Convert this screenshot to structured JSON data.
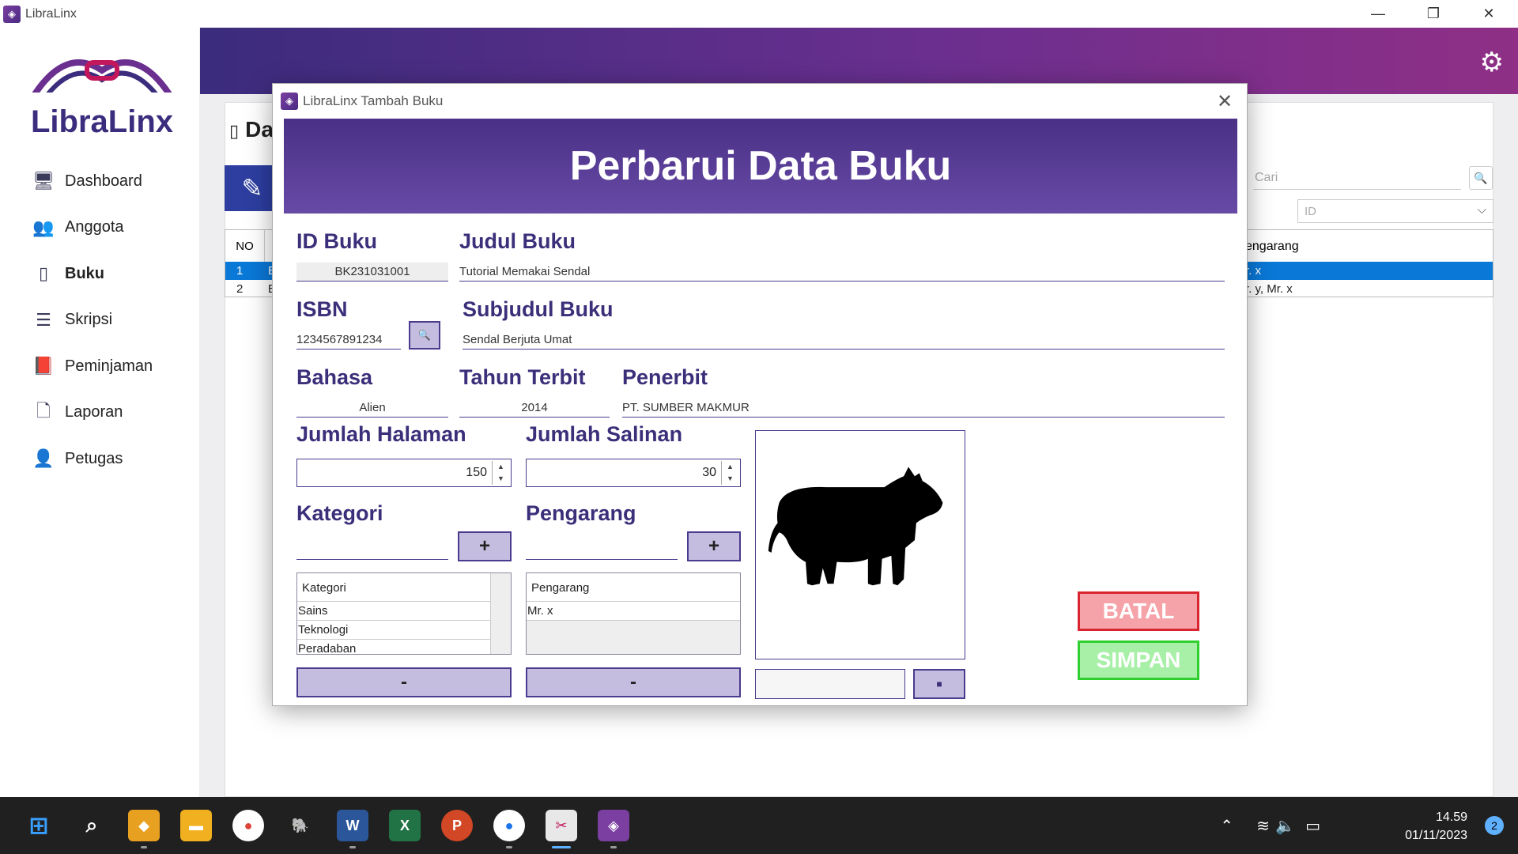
{
  "window": {
    "title": "LibraLinx",
    "minimize_icon": "minimize-icon",
    "restore_icon": "restore-icon",
    "close_icon": "close-icon"
  },
  "sidebar": {
    "logo_text": "LibraLinx",
    "items": [
      {
        "label": "Dashboard",
        "icon": "monitor-icon"
      },
      {
        "label": "Anggota",
        "icon": "users-icon"
      },
      {
        "label": "Buku",
        "icon": "book-icon",
        "active": true
      },
      {
        "label": "Skripsi",
        "icon": "list-icon"
      },
      {
        "label": "Peminjaman",
        "icon": "book-return-icon"
      },
      {
        "label": "Laporan",
        "icon": "report-icon"
      },
      {
        "label": "Petugas",
        "icon": "user-icon"
      }
    ]
  },
  "background_page": {
    "title": "Da",
    "search_placeholder": "Cari",
    "filter_value": "ID",
    "table": {
      "header_no": "NO",
      "header_pengarang": "engarang",
      "rows": [
        {
          "no": "1",
          "col2": "E",
          "pengarang": "r. x",
          "selected": true
        },
        {
          "no": "2",
          "col2": "E",
          "pengarang": "r. y, Mr. x",
          "selected": false
        }
      ]
    }
  },
  "modal": {
    "title": "LibraLinx Tambah Buku",
    "header": "Perbarui Data Buku",
    "labels": {
      "id_buku": "ID Buku",
      "judul_buku": "Judul Buku",
      "isbn": "ISBN",
      "subjudul_buku": "Subjudul Buku",
      "bahasa": "Bahasa",
      "tahun_terbit": "Tahun Terbit",
      "penerbit": "Penerbit",
      "jumlah_halaman": "Jumlah Halaman",
      "jumlah_salinan": "Jumlah Salinan",
      "kategori": "Kategori",
      "pengarang": "Pengarang"
    },
    "values": {
      "id_buku": "BK231031001",
      "judul_buku": "Tutorial Memakai Sendal",
      "isbn": "1234567891234",
      "subjudul_buku": "Sendal Berjuta Umat",
      "bahasa": "Alien",
      "tahun_terbit": "2014",
      "penerbit": "PT. SUMBER MAKMUR",
      "jumlah_halaman": "150",
      "jumlah_salinan": "30"
    },
    "kategori_list": {
      "header": "Kategori",
      "items": [
        "Sains",
        "Teknologi",
        "Peradaban"
      ]
    },
    "pengarang_list": {
      "header": "Pengarang",
      "items": [
        "Mr. x"
      ]
    },
    "plus_label": "+",
    "minus_label": "-",
    "image_icon": "cow-icon",
    "browse_icon": "folder-icon",
    "isbn_search_icon": "search-icon",
    "buttons": {
      "batal": "BATAL",
      "simpan": "SIMPAN"
    }
  },
  "taskbar": {
    "time": "14.59",
    "date": "01/11/2023",
    "notification_count": "2",
    "apps": [
      "start-icon",
      "search-icon",
      "app-cube-icon",
      "file-explorer-icon",
      "chrome-icon",
      "postgres-icon",
      "word-icon",
      "excel-icon",
      "powerpoint-icon",
      "chrome-dev-icon",
      "snipping-icon",
      "libralinx-icon"
    ]
  }
}
